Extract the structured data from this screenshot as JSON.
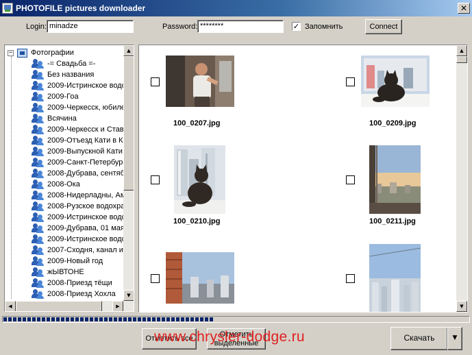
{
  "window": {
    "title": "PHOTOFILE pictures downloader",
    "close_glyph": "✕"
  },
  "login": {
    "login_label": "Login:",
    "login_value": "minadze",
    "password_label": "Password:",
    "password_value": "********",
    "remember_label": "Запомнить",
    "remember_checked": true,
    "remember_glyph": "✓",
    "connect_label": "Connect"
  },
  "tree": {
    "root_expander": "−",
    "root_label": "Фотографии",
    "items": [
      "-= Свадьба =-",
      "Без названия",
      "2009-Истринское водо",
      "2009-Гоа",
      "2009-Черкесск, юбиле",
      "Всячина",
      "2009-Черкесск и Став",
      "2009-Отъезд Кати в К",
      "2009-Выпускной Кати,",
      "2009-Санкт-Петербург",
      "2008-Дубрава, сентяб",
      "2008-Ока",
      "2008-Нидерладны, Ам",
      "2008-Рузское водохра",
      "2009-Истринское водо",
      "2009-Дубрава, 01 мая",
      "2009-Истринское водо",
      "2007-Сходня, канал им",
      "2009-Новый  год",
      "жЫВТОНЕ",
      "2008-Приезд  тёщи",
      "2008-Приезд  Хохла"
    ]
  },
  "thumbnails": [
    {
      "filename": "100_0207.jpg",
      "checked": false,
      "subject": "person-on-balcony"
    },
    {
      "filename": "100_0209.jpg",
      "checked": false,
      "subject": "cat-on-windowsill"
    },
    {
      "filename": "100_0210.jpg",
      "checked": false,
      "subject": "cat-with-buildings"
    },
    {
      "filename": "100_0211.jpg",
      "checked": false,
      "subject": "city-from-balcony"
    },
    {
      "filename": "",
      "checked": false,
      "subject": "balcony-view"
    },
    {
      "filename": "",
      "checked": false,
      "subject": "city-skyline"
    }
  ],
  "progress": {
    "fraction": 0.45
  },
  "actions": {
    "mark_all_label": "Отметить все",
    "mark_selected_label": "Отметить выделенные",
    "download_label": "Скачать",
    "dropdown_glyph": "▼"
  },
  "scroll_glyphs": {
    "up": "▲",
    "down": "▼",
    "left": "◀",
    "right": "▶"
  },
  "watermark": "www.chrysler-dodge.ru",
  "colors": {
    "titlebar_start": "#0a246a",
    "titlebar_end": "#a6caf0",
    "face": "#d4d0c8",
    "watermark": "#e02020"
  }
}
